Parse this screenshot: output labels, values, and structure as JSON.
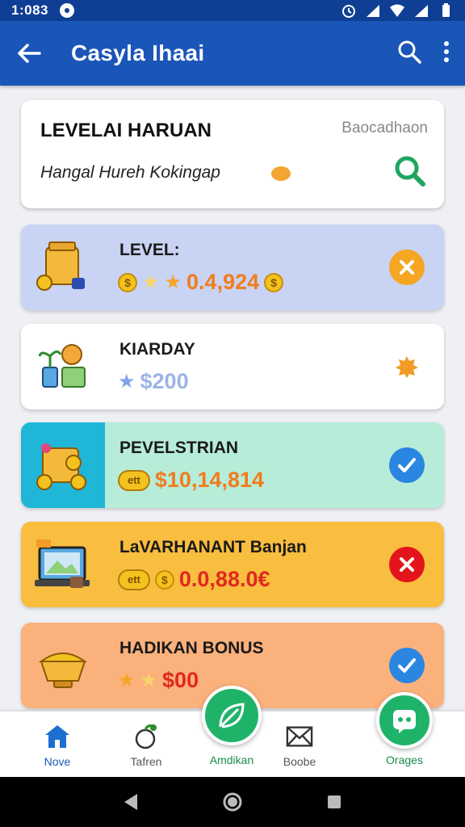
{
  "status_bar": {
    "time": "1:083"
  },
  "app_bar": {
    "title": "Casyla Ihaai"
  },
  "header_card": {
    "title": "LEVELAI HARUAN",
    "side_text": "Baocadhaon",
    "subtitle": "Hangal Hureh Kokingap"
  },
  "tasks": [
    {
      "title": "LEVEL:",
      "value": "0.4,924",
      "bg": "#c9d3f3",
      "value_color": "#f07d1c",
      "action": "close",
      "action_color": "#f5a623"
    },
    {
      "title": "KIARDAY",
      "value": "$200",
      "bg": "#ffffff",
      "value_color": "#9db3e6",
      "action": "badge",
      "action_color": "#f29b26"
    },
    {
      "title": "PEVELSTRIAN",
      "value": "$10,14,814",
      "pill": "ett",
      "bg": "#b7ecd9",
      "value_color": "#f07d1c",
      "action": "check",
      "action_color": "#2a86e0"
    },
    {
      "title": "LaVARHANANT Banjan",
      "value": "0.0,88.0€",
      "pill": "ett",
      "bg": "#f9bd3f",
      "value_color": "#e1281e",
      "action": "close",
      "action_color": "#e3141c"
    },
    {
      "title": "HADIKAN BONUS",
      "value": "$00",
      "bg": "#fbb17c",
      "value_color": "#e1281e",
      "action": "check",
      "action_color": "#2a86e0"
    }
  ],
  "bottom_nav": [
    {
      "label": "Nove",
      "icon": "home-icon"
    },
    {
      "label": "Tafren",
      "icon": "plant-icon"
    },
    {
      "label": "Amdikan",
      "icon": "leaf-icon"
    },
    {
      "label": "Boobe",
      "icon": "mail-icon"
    },
    {
      "label": "Orages",
      "icon": "chat-icon"
    }
  ]
}
